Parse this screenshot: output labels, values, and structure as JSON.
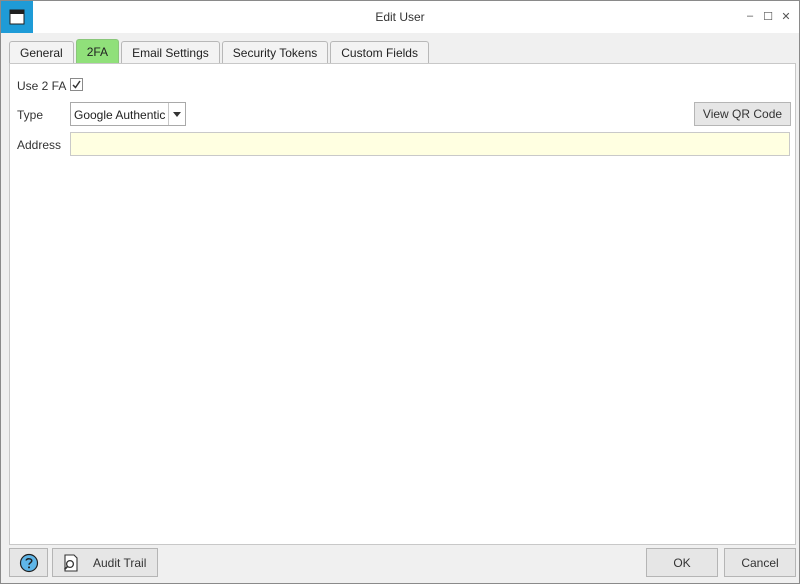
{
  "window": {
    "title": "Edit User",
    "accent_color": "#1e9bd7",
    "icon": "window-icon",
    "controls": {
      "minimize": "–",
      "maximize": "☐",
      "close": "✕"
    }
  },
  "tabs": [
    {
      "label": "General",
      "active": false
    },
    {
      "label": "2FA",
      "active": true
    },
    {
      "label": "Email Settings",
      "active": false
    },
    {
      "label": "Security Tokens",
      "active": false
    },
    {
      "label": "Custom Fields",
      "active": false
    }
  ],
  "tab_active_color": "#90e07a",
  "form": {
    "use2fa_label": "Use 2 FA",
    "use2fa_checked": true,
    "type_label": "Type",
    "type_value": "Google Authentic",
    "view_qr_label": "View QR Code",
    "address_label": "Address",
    "address_value": "",
    "address_bg": "#ffffe1"
  },
  "footer": {
    "help_icon": "help-icon",
    "audit_icon": "audit-trail-icon",
    "audit_label": "Audit Trail",
    "ok_label": "OK",
    "cancel_label": "Cancel"
  }
}
